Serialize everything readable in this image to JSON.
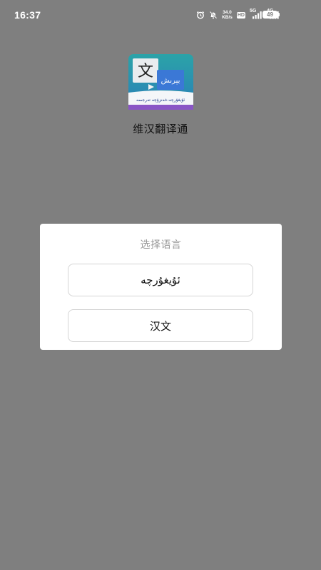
{
  "status_bar": {
    "time": "16:37",
    "net_speed_value": "34.0",
    "net_speed_unit": "KB/s",
    "hd_badge": "HD",
    "sim1_tag": "5G",
    "sim2_tag": "4G",
    "battery": "49",
    "icons": [
      "alarm-icon",
      "mute-icon",
      "hd-icon",
      "signal-5g-icon",
      "signal-4g-icon",
      "battery-icon"
    ]
  },
  "app": {
    "name": "维汉翻译通",
    "logo_char": "文",
    "logo_script": "ﺑﯧﺮﯨﺶ",
    "logo_banner": "ئۇيغۇرچە-خەنزۇچە تەرجىمە"
  },
  "dialog": {
    "title": "选择语言",
    "options": [
      {
        "label": "ئۇيغۇرچە"
      },
      {
        "label": "汉文"
      }
    ]
  },
  "colors": {
    "overlay": "#7f7f7f",
    "dialog_bg": "#ffffff",
    "title_text": "#9a9a9a",
    "button_border": "#d4d4d4",
    "logo_teal": "#2a8e9a",
    "logo_blue": "#2f6fc8"
  }
}
